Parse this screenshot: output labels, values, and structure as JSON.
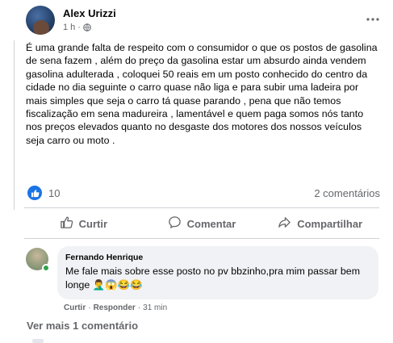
{
  "post": {
    "author": "Alex Urizzi",
    "time": "1 h",
    "separator": "·",
    "text": "É uma grande falta de respeito com o consumidor o que os postos de gasolina de sena fazem , além do preço da gasolina estar um absurdo ainda vendem gasolina adulterada , coloquei 50 reais em um posto conhecido do centro da cidade no dia seguinte o carro quase não liga e para subir uma ladeira por mais simples que seja o carro tá quase parando , pena que não temos fiscalização em sena madureira , lamentável e quem paga somos nós  tanto nos preços elevados quanto no desgaste dos motores dos nossos veículos seja carro ou moto ."
  },
  "reactions": {
    "count": "10",
    "comments": "2 comentários"
  },
  "actions": {
    "like": "Curtir",
    "comment": "Comentar",
    "share": "Compartilhar"
  },
  "comment": {
    "author": "Fernando Henrique",
    "text": "Me fale mais sobre esse posto no pv bbzinho,pra mim passar bem longe 🤦‍♂️😱😂😂",
    "like": "Curtir",
    "reply": "Responder",
    "dot": "·",
    "time": "31 min"
  },
  "more_comments": "Ver mais 1 comentário",
  "colors": {
    "accent": "#1b74e4",
    "online": "#31a24c",
    "muted": "#65676b"
  },
  "icons": [
    "globe-icon",
    "more-options-icon",
    "like-reaction-icon",
    "thumbs-up-icon",
    "comment-icon",
    "share-icon"
  ]
}
